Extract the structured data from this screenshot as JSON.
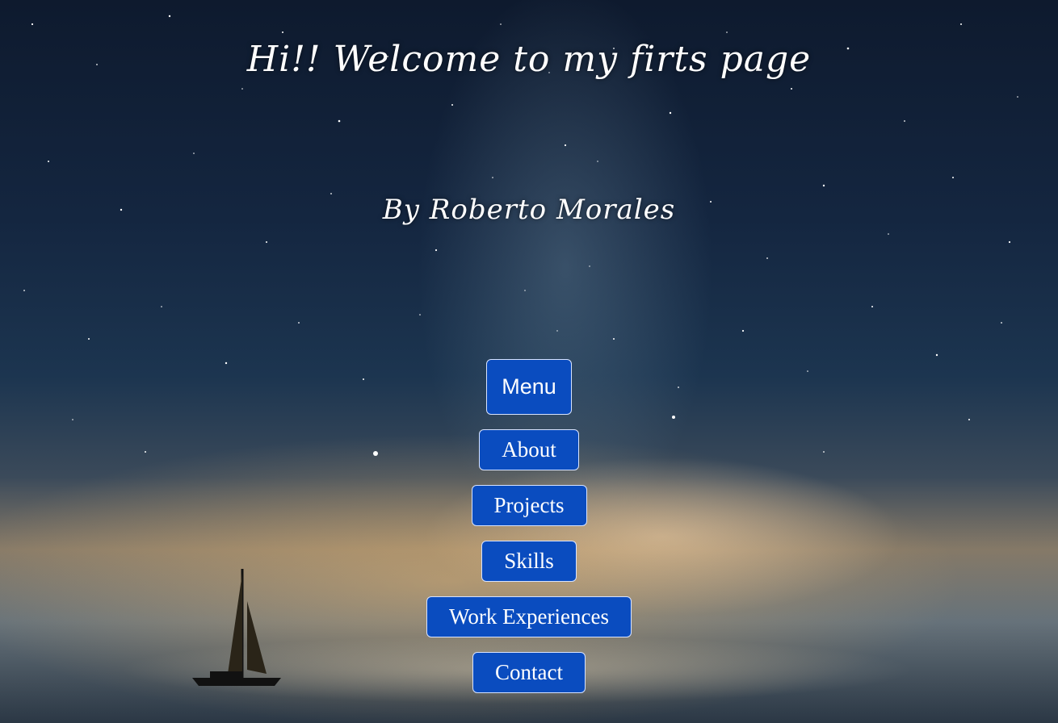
{
  "page": {
    "title": "Hi!! Welcome to my firts page",
    "subtitle": "By Roberto Morales"
  },
  "menu": {
    "toggle_label": "Menu",
    "items": [
      {
        "label": "About"
      },
      {
        "label": "Projects"
      },
      {
        "label": "Skills"
      },
      {
        "label": "Work Experiences"
      },
      {
        "label": "Contact"
      }
    ]
  },
  "colors": {
    "button_bg": "#0a4cbf",
    "button_border": "#d7e3ff",
    "text": "#ffffff"
  },
  "background": {
    "description_icon": "night-sky-sailboat-image"
  }
}
